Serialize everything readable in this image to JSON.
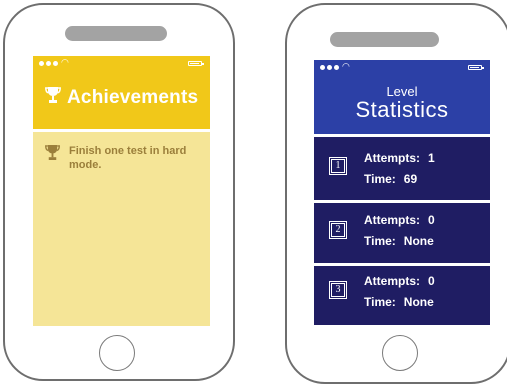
{
  "achievements": {
    "title": "Achievements",
    "items": [
      {
        "text": "Finish one test in hard mode."
      }
    ]
  },
  "statistics": {
    "header_small": "Level",
    "header_large": "Statistics",
    "levels": [
      {
        "number": "1",
        "attempts_label": "Attempts:",
        "attempts": "1",
        "time_label": "Time:",
        "time": "69"
      },
      {
        "number": "2",
        "attempts_label": "Attempts:",
        "attempts": "0",
        "time_label": "Time:",
        "time": "None"
      },
      {
        "number": "3",
        "attempts_label": "Attempts:",
        "attempts": "0",
        "time_label": "Time:",
        "time": "None"
      }
    ]
  },
  "colors": {
    "achievements_header": "#f1c819",
    "achievements_body": "#f5e597",
    "achievements_text": "#9b7f3b",
    "statistics_header": "#2c40a6",
    "statistics_body": "#1f1d63"
  },
  "icons": {
    "trophy": "trophy-icon",
    "signal": "signal-dots-icon",
    "wifi": "wifi-icon",
    "battery": "battery-icon"
  }
}
